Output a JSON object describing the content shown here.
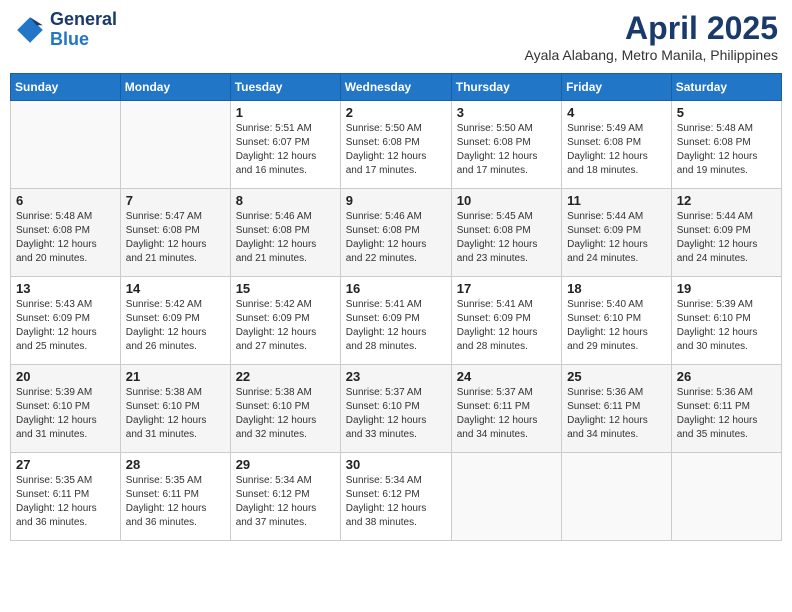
{
  "header": {
    "logo_line1": "General",
    "logo_line2": "Blue",
    "month": "April 2025",
    "location": "Ayala Alabang, Metro Manila, Philippines"
  },
  "weekdays": [
    "Sunday",
    "Monday",
    "Tuesday",
    "Wednesday",
    "Thursday",
    "Friday",
    "Saturday"
  ],
  "weeks": [
    [
      {
        "day": "",
        "info": ""
      },
      {
        "day": "",
        "info": ""
      },
      {
        "day": "1",
        "sunrise": "5:51 AM",
        "sunset": "6:07 PM",
        "daylight": "12 hours and 16 minutes."
      },
      {
        "day": "2",
        "sunrise": "5:50 AM",
        "sunset": "6:08 PM",
        "daylight": "12 hours and 17 minutes."
      },
      {
        "day": "3",
        "sunrise": "5:50 AM",
        "sunset": "6:08 PM",
        "daylight": "12 hours and 17 minutes."
      },
      {
        "day": "4",
        "sunrise": "5:49 AM",
        "sunset": "6:08 PM",
        "daylight": "12 hours and 18 minutes."
      },
      {
        "day": "5",
        "sunrise": "5:48 AM",
        "sunset": "6:08 PM",
        "daylight": "12 hours and 19 minutes."
      }
    ],
    [
      {
        "day": "6",
        "sunrise": "5:48 AM",
        "sunset": "6:08 PM",
        "daylight": "12 hours and 20 minutes."
      },
      {
        "day": "7",
        "sunrise": "5:47 AM",
        "sunset": "6:08 PM",
        "daylight": "12 hours and 21 minutes."
      },
      {
        "day": "8",
        "sunrise": "5:46 AM",
        "sunset": "6:08 PM",
        "daylight": "12 hours and 21 minutes."
      },
      {
        "day": "9",
        "sunrise": "5:46 AM",
        "sunset": "6:08 PM",
        "daylight": "12 hours and 22 minutes."
      },
      {
        "day": "10",
        "sunrise": "5:45 AM",
        "sunset": "6:08 PM",
        "daylight": "12 hours and 23 minutes."
      },
      {
        "day": "11",
        "sunrise": "5:44 AM",
        "sunset": "6:09 PM",
        "daylight": "12 hours and 24 minutes."
      },
      {
        "day": "12",
        "sunrise": "5:44 AM",
        "sunset": "6:09 PM",
        "daylight": "12 hours and 24 minutes."
      }
    ],
    [
      {
        "day": "13",
        "sunrise": "5:43 AM",
        "sunset": "6:09 PM",
        "daylight": "12 hours and 25 minutes."
      },
      {
        "day": "14",
        "sunrise": "5:42 AM",
        "sunset": "6:09 PM",
        "daylight": "12 hours and 26 minutes."
      },
      {
        "day": "15",
        "sunrise": "5:42 AM",
        "sunset": "6:09 PM",
        "daylight": "12 hours and 27 minutes."
      },
      {
        "day": "16",
        "sunrise": "5:41 AM",
        "sunset": "6:09 PM",
        "daylight": "12 hours and 28 minutes."
      },
      {
        "day": "17",
        "sunrise": "5:41 AM",
        "sunset": "6:09 PM",
        "daylight": "12 hours and 28 minutes."
      },
      {
        "day": "18",
        "sunrise": "5:40 AM",
        "sunset": "6:10 PM",
        "daylight": "12 hours and 29 minutes."
      },
      {
        "day": "19",
        "sunrise": "5:39 AM",
        "sunset": "6:10 PM",
        "daylight": "12 hours and 30 minutes."
      }
    ],
    [
      {
        "day": "20",
        "sunrise": "5:39 AM",
        "sunset": "6:10 PM",
        "daylight": "12 hours and 31 minutes."
      },
      {
        "day": "21",
        "sunrise": "5:38 AM",
        "sunset": "6:10 PM",
        "daylight": "12 hours and 31 minutes."
      },
      {
        "day": "22",
        "sunrise": "5:38 AM",
        "sunset": "6:10 PM",
        "daylight": "12 hours and 32 minutes."
      },
      {
        "day": "23",
        "sunrise": "5:37 AM",
        "sunset": "6:10 PM",
        "daylight": "12 hours and 33 minutes."
      },
      {
        "day": "24",
        "sunrise": "5:37 AM",
        "sunset": "6:11 PM",
        "daylight": "12 hours and 34 minutes."
      },
      {
        "day": "25",
        "sunrise": "5:36 AM",
        "sunset": "6:11 PM",
        "daylight": "12 hours and 34 minutes."
      },
      {
        "day": "26",
        "sunrise": "5:36 AM",
        "sunset": "6:11 PM",
        "daylight": "12 hours and 35 minutes."
      }
    ],
    [
      {
        "day": "27",
        "sunrise": "5:35 AM",
        "sunset": "6:11 PM",
        "daylight": "12 hours and 36 minutes."
      },
      {
        "day": "28",
        "sunrise": "5:35 AM",
        "sunset": "6:11 PM",
        "daylight": "12 hours and 36 minutes."
      },
      {
        "day": "29",
        "sunrise": "5:34 AM",
        "sunset": "6:12 PM",
        "daylight": "12 hours and 37 minutes."
      },
      {
        "day": "30",
        "sunrise": "5:34 AM",
        "sunset": "6:12 PM",
        "daylight": "12 hours and 38 minutes."
      },
      {
        "day": "",
        "info": ""
      },
      {
        "day": "",
        "info": ""
      },
      {
        "day": "",
        "info": ""
      }
    ]
  ]
}
